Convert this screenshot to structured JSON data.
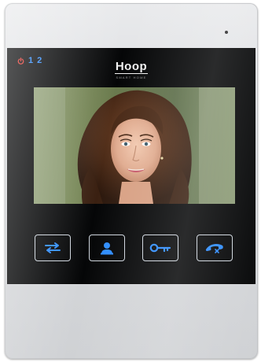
{
  "device": {
    "brand_name": "Hoop",
    "brand_tagline": "SMART HOME",
    "indicators": {
      "power_icon": "power-icon",
      "line_1": "1",
      "line_2": "2"
    },
    "buttons": [
      {
        "name": "transfer-button",
        "icon": "transfer-arrows-icon"
      },
      {
        "name": "monitor-button",
        "icon": "person-icon"
      },
      {
        "name": "unlock-button",
        "icon": "key-icon"
      },
      {
        "name": "hangup-button",
        "icon": "phone-hangup-icon"
      }
    ],
    "screen_content": "video-feed",
    "colors": {
      "accent_blue": "#2d8cff",
      "power_red": "#e8332b",
      "panel": "#050607",
      "body": "#d9dbde"
    }
  }
}
